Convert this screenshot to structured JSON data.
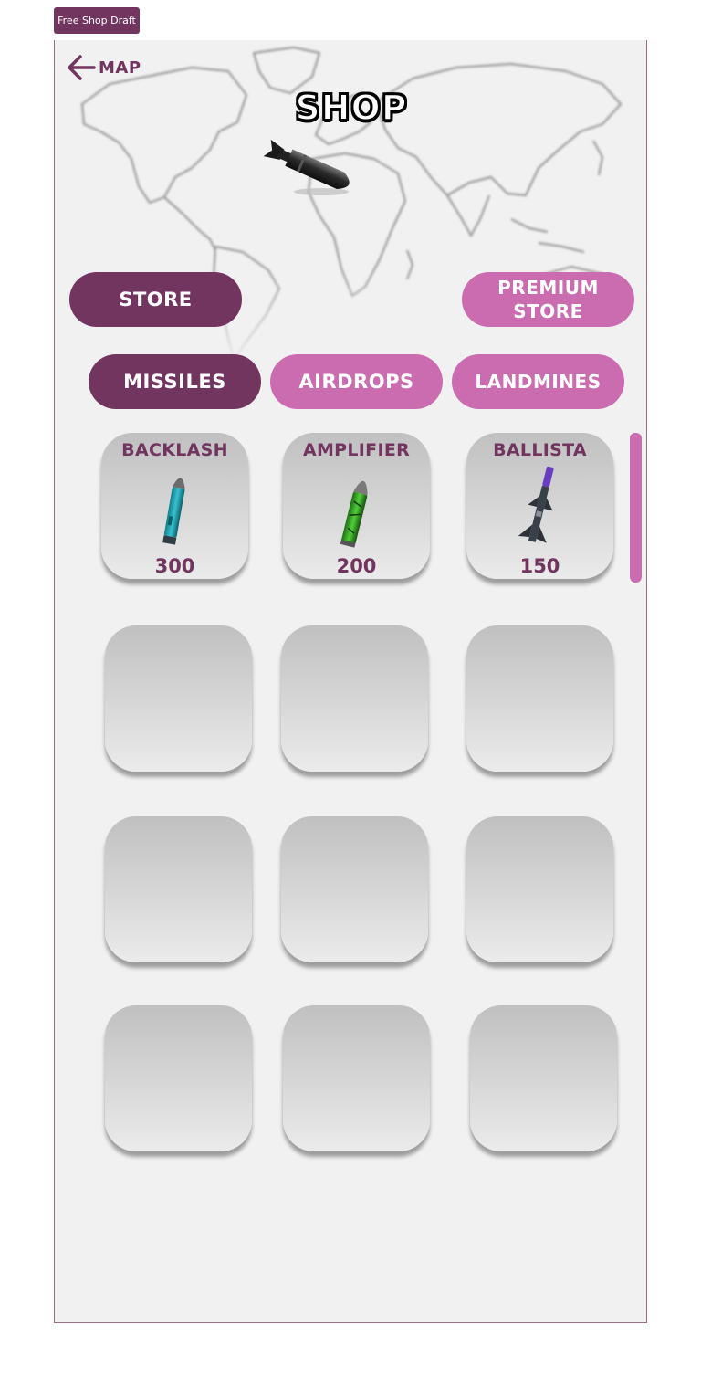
{
  "draft_tag": "Free Shop Draft",
  "header": {
    "back_label": "MAP",
    "title": "SHOP"
  },
  "store_buttons": {
    "store": "STORE",
    "premium_line1": "PREMIUM",
    "premium_line2": "STORE"
  },
  "tabs": {
    "missiles": "MISSILES",
    "airdrops": "AIRDROPS",
    "landmines": "LANDMINES",
    "active": "missiles"
  },
  "items": [
    {
      "name": "BACKLASH",
      "price": "300",
      "icon": "teal-missile-icon"
    },
    {
      "name": "AMPLIFIER",
      "price": "200",
      "icon": "green-missile-icon"
    },
    {
      "name": "BALLISTA",
      "price": "150",
      "icon": "finned-missile-icon"
    }
  ],
  "colors": {
    "primary": "#723560",
    "accent": "#cc6cb0",
    "background": "#f1f1f1",
    "tile_top": "#c0c0c0",
    "tile_bottom": "#ebebeb"
  }
}
